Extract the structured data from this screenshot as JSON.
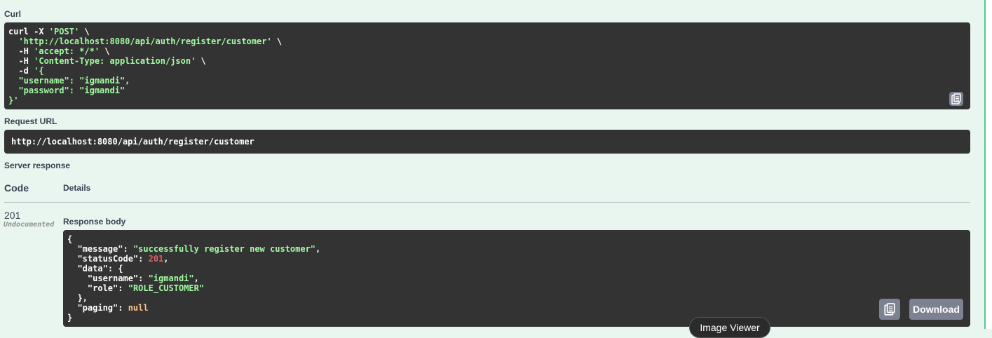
{
  "curl": {
    "label": "Curl",
    "line1_cmd": "curl -X ",
    "line1_method": "'POST'",
    "line1_end": " \\",
    "line2_url": "'http://localhost:8080/api/auth/register/customer'",
    "line2_end": " \\",
    "line3_flag": "  -H ",
    "line3_val": "'accept: */*'",
    "line3_end": " \\",
    "line4_flag": "  -H ",
    "line4_val": "'Content-Type: application/json'",
    "line4_end": " \\",
    "line5_flag": "  -d ",
    "line5_val": "'{",
    "line6": "  \"username\": \"igmandi\",",
    "line7": "  \"password\": \"igmandi\"",
    "line8": "}'",
    "copy_icon": "clipboard-icon"
  },
  "request_url": {
    "label": "Request URL",
    "value": "http://localhost:8080/api/auth/register/customer"
  },
  "server_response": {
    "label": "Server response",
    "col_code": "Code",
    "col_details": "Details",
    "code": "201",
    "code_note": "Undocumented",
    "response_body_label": "Response body",
    "body": {
      "open": "{",
      "message_key": "\"message\"",
      "message_val": "\"successfully register new customer\"",
      "status_key": "\"statusCode\"",
      "status_val": "201",
      "data_key": "\"data\"",
      "username_key": "\"username\"",
      "username_val": "\"igmandi\"",
      "role_key": "\"role\"",
      "role_val": "\"ROLE_CUSTOMER\"",
      "paging_key": "\"paging\"",
      "paging_val": "null",
      "close": "}"
    },
    "download_label": "Download",
    "copy_icon": "clipboard-icon"
  },
  "tooltip": {
    "text": "Image Viewer"
  },
  "colors": {
    "background": "#e9f6f0",
    "code_background": "#333333",
    "string": "#a2fca2",
    "number": "#d36363",
    "literal": "#fcc28c",
    "button": "#7d8293",
    "accent_border": "#49cc90"
  }
}
